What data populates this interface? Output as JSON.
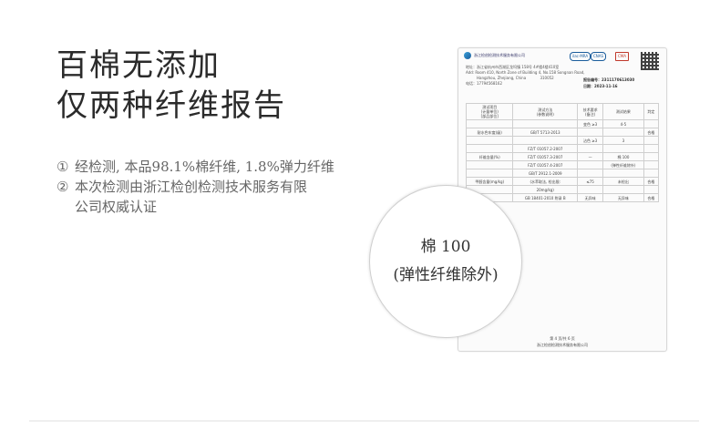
{
  "title": {
    "line1": "百棉无添加",
    "line2": "仅两种纤维报告"
  },
  "notes": [
    {
      "num": "①",
      "text": "经检测, 本品98.1%棉纤维, 1.8%弹力纤维"
    },
    {
      "num": "②",
      "text": "本次检测由浙江检创检测技术服务有限"
    },
    {
      "num": "",
      "text": "公司权威认证"
    }
  ],
  "badge": {
    "line1": "棉 100",
    "line2": "(弹性纤维除外)"
  },
  "report": {
    "org": "浙江检创检测技术服务有限公司",
    "cert_labels": [
      "ilac-MRA",
      "CNAS",
      "CMA"
    ],
    "address_cn": "地址：浙江省杭州市西湖区龙坞镇 158号 4#楼4楼410室",
    "address_en": "Add: Room 410, North Zone of Building 4, No.158 Songnan Road,",
    "address_city": "Hangzhou, Zhejiang, China",
    "postcode": "310052",
    "phone": "电话：17794568162",
    "report_no": "报告编号：2311170613030",
    "date": "日期：2023-11-16",
    "table": {
      "header": [
        "测试项目\n(计量单位)\n[部品部位]",
        "测试方法\n(参数说明)",
        "技术要求\n(备注)",
        "测试结果",
        "判定"
      ],
      "rows": [
        [
          "",
          "",
          "变色 ≥3",
          "4-5",
          ""
        ],
        [
          "耐水色牢度(级)",
          "GB/T 5713-2013",
          "",
          "",
          "合格"
        ],
        [
          "",
          "",
          "沾色 ≥3",
          "3",
          ""
        ],
        [
          "",
          "FZ/T 01057.2-2007",
          "",
          "",
          ""
        ],
        [
          "纤维含量(%)",
          "FZ/T 01057.3-2007",
          "—",
          "棉 100",
          ""
        ],
        [
          "",
          "FZ/T 01057.4-2007",
          "",
          "(弹性纤维除外)",
          ""
        ],
        [
          "",
          "GB/T 2912.1-2009",
          "",
          "",
          ""
        ],
        [
          "甲醛含量(mg/kg)",
          "(水萃取法, 检出限:",
          "≤75",
          "未检出",
          "合格"
        ],
        [
          "",
          "20mg/kg)",
          "",
          "",
          ""
        ],
        [
          "",
          "GB 18401-2010 附录 B",
          "无异味",
          "无异味",
          "合格"
        ]
      ]
    },
    "footer_page": "第 4 页/共 6 页",
    "footer_org": "浙江检创检测技术服务有限公司"
  }
}
